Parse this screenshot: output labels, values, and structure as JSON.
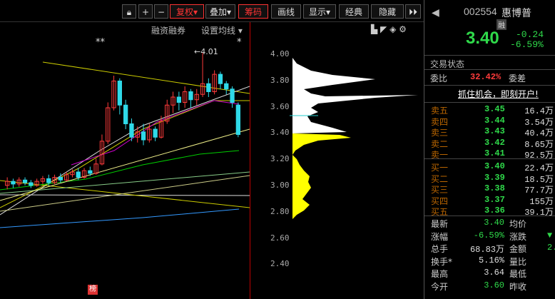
{
  "toolbar": {
    "buttons": [
      "复权",
      "叠加",
      "筹码",
      "画线",
      "显示",
      "经典",
      "隐藏"
    ],
    "sub_left": "融资融券",
    "sub_right": "设置均线"
  },
  "chart": {
    "stars_left": "**",
    "stars_right": "*",
    "high_label": "4.01",
    "badge": "榜"
  },
  "chart_data": {
    "type": "candlestick",
    "ylim": [
      2.4,
      4.0
    ],
    "yticks": [
      "4.00",
      "3.80",
      "3.60",
      "3.40",
      "3.20",
      "3.00",
      "2.80",
      "2.60",
      "2.40"
    ],
    "candles": [
      {
        "o": 3.02,
        "c": 3.05,
        "h": 3.08,
        "l": 2.99
      },
      {
        "o": 3.05,
        "c": 3.03,
        "h": 3.07,
        "l": 3.0
      },
      {
        "o": 3.03,
        "c": 3.06,
        "h": 3.08,
        "l": 3.01
      },
      {
        "o": 3.06,
        "c": 3.04,
        "h": 3.08,
        "l": 3.02
      },
      {
        "o": 3.04,
        "c": 3.02,
        "h": 3.06,
        "l": 3.0
      },
      {
        "o": 3.02,
        "c": 3.05,
        "h": 3.07,
        "l": 3.01
      },
      {
        "o": 3.05,
        "c": 3.07,
        "h": 3.09,
        "l": 3.03
      },
      {
        "o": 3.07,
        "c": 3.04,
        "h": 3.1,
        "l": 3.02
      },
      {
        "o": 3.04,
        "c": 3.08,
        "h": 3.1,
        "l": 3.03
      },
      {
        "o": 3.08,
        "c": 3.06,
        "h": 3.11,
        "l": 3.04
      },
      {
        "o": 3.06,
        "c": 3.1,
        "h": 3.12,
        "l": 3.05
      },
      {
        "o": 3.1,
        "c": 3.12,
        "h": 3.14,
        "l": 3.08
      },
      {
        "o": 3.12,
        "c": 3.08,
        "h": 3.15,
        "l": 3.06
      },
      {
        "o": 3.08,
        "c": 3.13,
        "h": 3.15,
        "l": 3.07
      },
      {
        "o": 3.13,
        "c": 3.11,
        "h": 3.16,
        "l": 3.09
      },
      {
        "o": 3.11,
        "c": 3.18,
        "h": 3.22,
        "l": 3.1
      },
      {
        "o": 3.18,
        "c": 3.35,
        "h": 3.4,
        "l": 3.17
      },
      {
        "o": 3.35,
        "c": 3.6,
        "h": 3.64,
        "l": 3.33
      },
      {
        "o": 3.6,
        "c": 3.8,
        "h": 3.84,
        "l": 3.58
      },
      {
        "o": 3.8,
        "c": 3.62,
        "h": 3.82,
        "l": 3.55
      },
      {
        "o": 3.62,
        "c": 3.48,
        "h": 3.66,
        "l": 3.44
      },
      {
        "o": 3.48,
        "c": 3.38,
        "h": 3.52,
        "l": 3.35
      },
      {
        "o": 3.38,
        "c": 3.42,
        "h": 3.46,
        "l": 3.34
      },
      {
        "o": 3.42,
        "c": 3.36,
        "h": 3.48,
        "l": 3.32
      },
      {
        "o": 3.36,
        "c": 3.44,
        "h": 3.48,
        "l": 3.34
      },
      {
        "o": 3.44,
        "c": 3.38,
        "h": 3.46,
        "l": 3.35
      },
      {
        "o": 3.38,
        "c": 3.5,
        "h": 3.54,
        "l": 3.37
      },
      {
        "o": 3.5,
        "c": 3.62,
        "h": 3.66,
        "l": 3.48
      },
      {
        "o": 3.62,
        "c": 3.68,
        "h": 3.72,
        "l": 3.56
      },
      {
        "o": 3.68,
        "c": 3.64,
        "h": 3.72,
        "l": 3.58
      },
      {
        "o": 3.64,
        "c": 3.72,
        "h": 3.76,
        "l": 3.6
      },
      {
        "o": 3.72,
        "c": 3.66,
        "h": 3.74,
        "l": 3.6
      },
      {
        "o": 3.66,
        "c": 3.7,
        "h": 3.74,
        "l": 3.62
      },
      {
        "o": 3.7,
        "c": 3.78,
        "h": 4.01,
        "l": 3.68
      },
      {
        "o": 3.78,
        "c": 3.72,
        "h": 3.82,
        "l": 3.68
      },
      {
        "o": 3.72,
        "c": 3.85,
        "h": 3.88,
        "l": 3.7
      },
      {
        "o": 3.85,
        "c": 3.78,
        "h": 3.87,
        "l": 3.74
      },
      {
        "o": 3.78,
        "c": 3.74,
        "h": 3.8,
        "l": 3.7
      },
      {
        "o": 3.74,
        "c": 3.64,
        "h": 3.76,
        "l": 3.6
      },
      {
        "o": 3.62,
        "c": 3.4,
        "h": 3.64,
        "l": 3.38
      }
    ]
  },
  "panel": {
    "code": "002554",
    "name": "惠博普",
    "margin_tag": "融",
    "price": "3.40",
    "change": "-0.24",
    "change_pct": "-6.59%",
    "trade_status": "交易状态",
    "weibi_label": "委比",
    "weibi_value": "32.42%",
    "weicha_label": "委差",
    "promo": "抓住机会，即刻开户!",
    "asks": [
      {
        "label": "卖五",
        "price": "3.45",
        "vol": "16.4万"
      },
      {
        "label": "卖四",
        "price": "3.44",
        "vol": "3.54万"
      },
      {
        "label": "卖三",
        "price": "3.43",
        "vol": "40.4万"
      },
      {
        "label": "卖二",
        "price": "3.42",
        "vol": "8.65万"
      },
      {
        "label": "卖一",
        "price": "3.41",
        "vol": "92.5万"
      }
    ],
    "bids": [
      {
        "label": "买一",
        "price": "3.40",
        "vol": "22.4万"
      },
      {
        "label": "买二",
        "price": "3.39",
        "vol": "18.5万"
      },
      {
        "label": "买三",
        "price": "3.38",
        "vol": "77.7万"
      },
      {
        "label": "买四",
        "price": "3.37",
        "vol": "155万"
      },
      {
        "label": "买五",
        "price": "3.36",
        "vol": "39.1万"
      }
    ],
    "stats": [
      {
        "l1": "最新",
        "v1": "3.40",
        "c1": "green",
        "l2": "均价",
        "v2": ""
      },
      {
        "l1": "涨幅",
        "v1": "-6.59%",
        "c1": "green",
        "l2": "涨跌",
        "v2": "▼"
      },
      {
        "l1": "总手",
        "v1": "68.83万",
        "c1": "white",
        "l2": "金额",
        "v2": "2."
      },
      {
        "l1": "换手*",
        "v1": "5.16%",
        "c1": "white",
        "l2": "量比",
        "v2": ""
      },
      {
        "l1": "最高",
        "v1": "3.64",
        "c1": "white",
        "l2": "最低",
        "v2": ""
      },
      {
        "l1": "今开",
        "v1": "3.60",
        "c1": "green",
        "l2": "昨收",
        "v2": ""
      }
    ]
  }
}
